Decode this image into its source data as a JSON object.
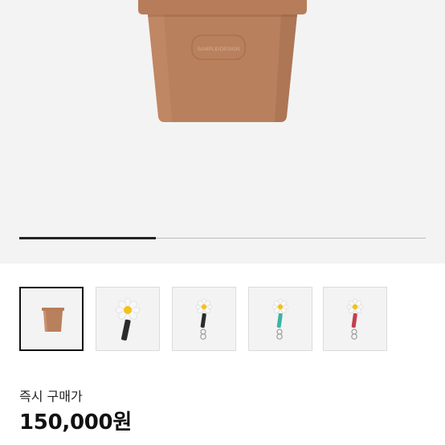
{
  "product": {
    "pot_brand_text": "SAMPLE/DESIGN",
    "gallery_progress": 0.335,
    "thumbnails": [
      {
        "name": "thumb-flower-pot",
        "icon": "flower-pot",
        "selected": true
      },
      {
        "name": "thumb-lightstick-black",
        "icon": "daisy-lightstick",
        "color": "#2b2b2b",
        "selected": false
      },
      {
        "name": "thumb-keyring-black",
        "icon": "daisy-keyring",
        "color": "#2b2b2b",
        "selected": false
      },
      {
        "name": "thumb-keyring-mint",
        "icon": "daisy-keyring",
        "color": "#3bb3a6",
        "selected": false
      },
      {
        "name": "thumb-keyring-red",
        "icon": "daisy-keyring",
        "color": "#c2404f",
        "selected": false
      }
    ],
    "price_label": "즉시 구매가",
    "price": "150,000원"
  },
  "colors": {
    "pot": "#b9805d",
    "pot_shade": "#a36e4f",
    "hero_bg": "#f3f3f3",
    "daisy_center": "#f2c21a"
  }
}
